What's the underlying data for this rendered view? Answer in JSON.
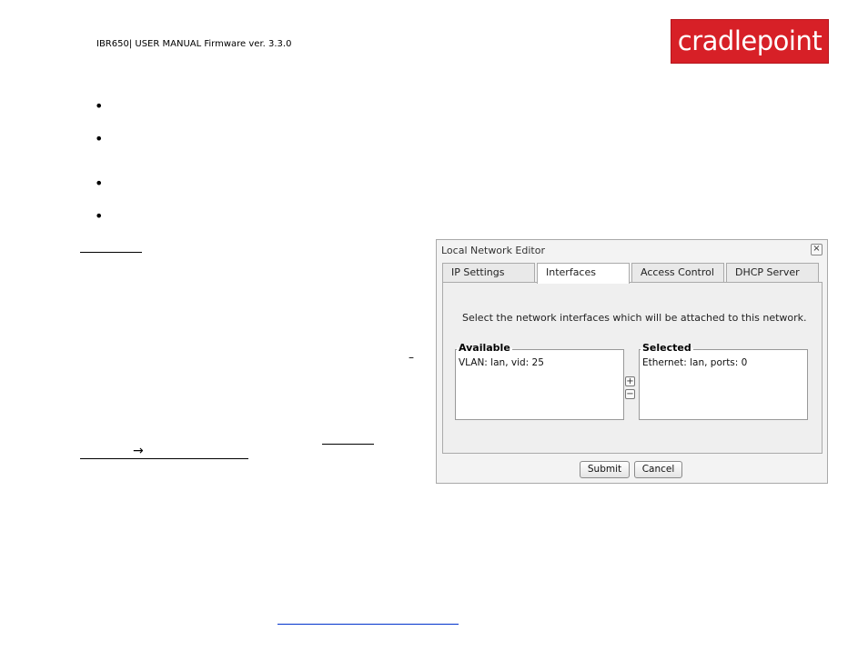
{
  "header": {
    "text": "IBR650| USER MANUAL Firmware ver. 3.3.0",
    "logo_text": "cradlepoint",
    "logo_color": "#d72027"
  },
  "body": {
    "dash": "–",
    "arrow": "→"
  },
  "dialog": {
    "title": "Local Network Editor",
    "close_glyph": "×",
    "tabs": [
      {
        "label": "IP Settings",
        "active": false
      },
      {
        "label": "Interfaces",
        "active": true
      },
      {
        "label": "Access Control",
        "active": false
      },
      {
        "label": "DHCP Server",
        "active": false
      }
    ],
    "instruction": "Select the network interfaces which will be attached to this network.",
    "available": {
      "label": "Available",
      "items": [
        "VLAN: lan, vid: 25"
      ]
    },
    "selected": {
      "label": "Selected",
      "items": [
        "Ethernet: lan, ports: 0"
      ]
    },
    "add_glyph": "+",
    "remove_glyph": "−",
    "submit_label": "Submit",
    "cancel_label": "Cancel"
  }
}
